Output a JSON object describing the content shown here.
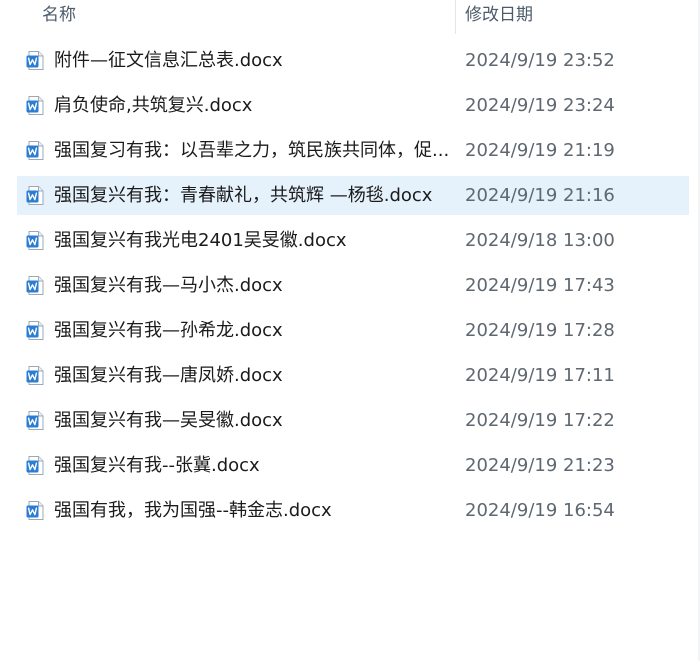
{
  "header": {
    "name_label": "名称",
    "date_label": "修改日期",
    "sort_indicator": "^"
  },
  "files": [
    {
      "name": "附件—征文信息汇总表.docx",
      "modified": "2024/9/19 23:52",
      "icon": "word-doc-icon",
      "selected": false
    },
    {
      "name": "肩负使命,共筑复兴.docx",
      "modified": "2024/9/19 23:24",
      "icon": "word-doc-icon",
      "selected": false
    },
    {
      "name": "强国复习有我：以吾辈之力，筑民族共同体，促...",
      "modified": "2024/9/19 21:19",
      "icon": "word-doc-icon",
      "selected": false
    },
    {
      "name": "强国复兴有我：青春献礼，共筑辉 —杨毯.docx",
      "modified": "2024/9/19 21:16",
      "icon": "word-doc-icon",
      "selected": true
    },
    {
      "name": "强国复兴有我光电2401吴旻徽.docx",
      "modified": "2024/9/18 13:00",
      "icon": "word-doc-icon",
      "selected": false
    },
    {
      "name": "强国复兴有我—马小杰.docx",
      "modified": "2024/9/19 17:43",
      "icon": "word-doc-icon",
      "selected": false
    },
    {
      "name": "强国复兴有我—孙希龙.docx",
      "modified": "2024/9/19 17:28",
      "icon": "word-doc-icon",
      "selected": false
    },
    {
      "name": "强国复兴有我—唐凤娇.docx",
      "modified": "2024/9/19 17:11",
      "icon": "word-doc-icon",
      "selected": false
    },
    {
      "name": "强国复兴有我—吴旻徽.docx",
      "modified": "2024/9/19 17:22",
      "icon": "word-doc-icon",
      "selected": false
    },
    {
      "name": "强国复兴有我--张冀.docx",
      "modified": "2024/9/19 21:23",
      "icon": "word-doc-icon",
      "selected": false
    },
    {
      "name": "强国有我，我为国强--韩金志.docx",
      "modified": "2024/9/19 16:54",
      "icon": "word-doc-icon",
      "selected": false
    }
  ],
  "colors": {
    "selection_bg": "#e5f1fb",
    "word_blue": "#2b7cd3",
    "header_text": "#4d5b6b",
    "date_text": "#5f6770"
  }
}
